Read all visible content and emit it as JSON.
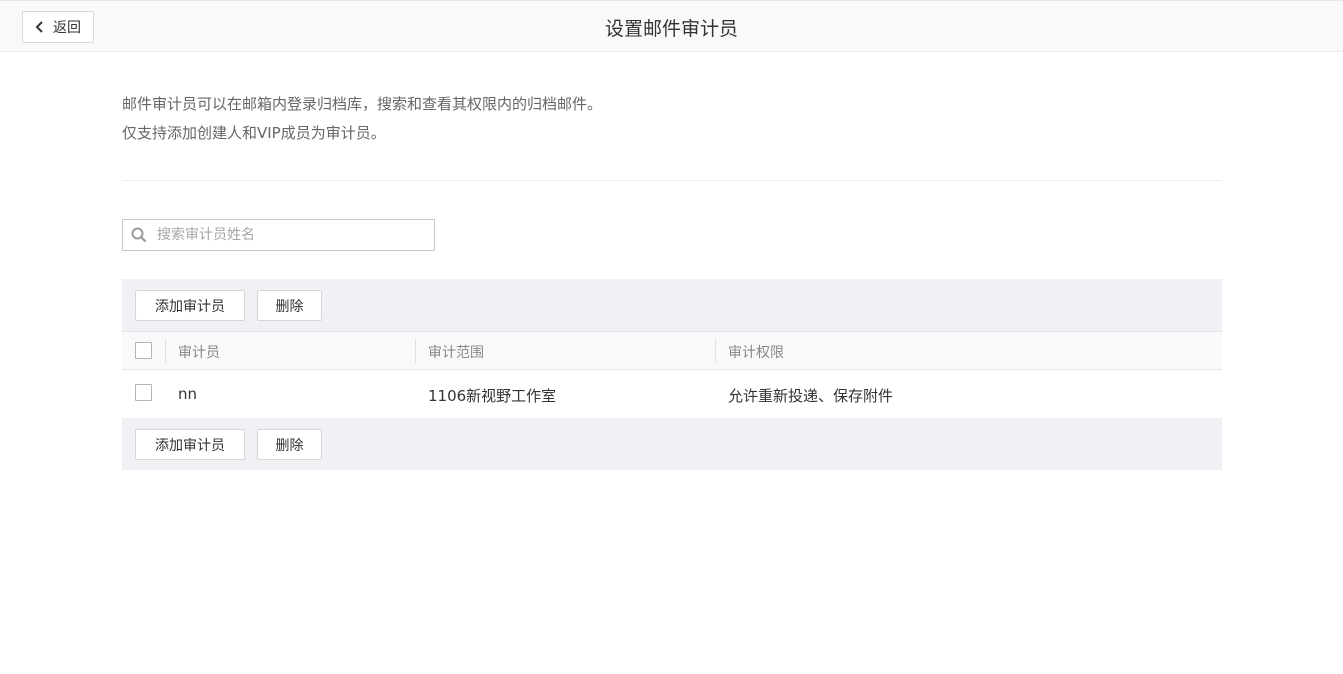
{
  "header": {
    "back_label": "返回",
    "title": "设置邮件审计员"
  },
  "intro": {
    "line1": "邮件审计员可以在邮箱内登录归档库，搜索和查看其权限内的归档邮件。",
    "line2": "仅支持添加创建人和VIP成员为审计员。"
  },
  "search": {
    "placeholder": "搜索审计员姓名",
    "value": ""
  },
  "toolbar": {
    "add_label": "添加审计员",
    "delete_label": "删除"
  },
  "table": {
    "columns": [
      "审计员",
      "审计范围",
      "审计权限"
    ],
    "rows": [
      {
        "auditor": "nn",
        "scope": "1106新视野工作室",
        "permission": "允许重新投递、保存附件",
        "checked": false
      }
    ]
  },
  "icons": {
    "back": "chevron-left-icon",
    "search": "search-icon"
  }
}
